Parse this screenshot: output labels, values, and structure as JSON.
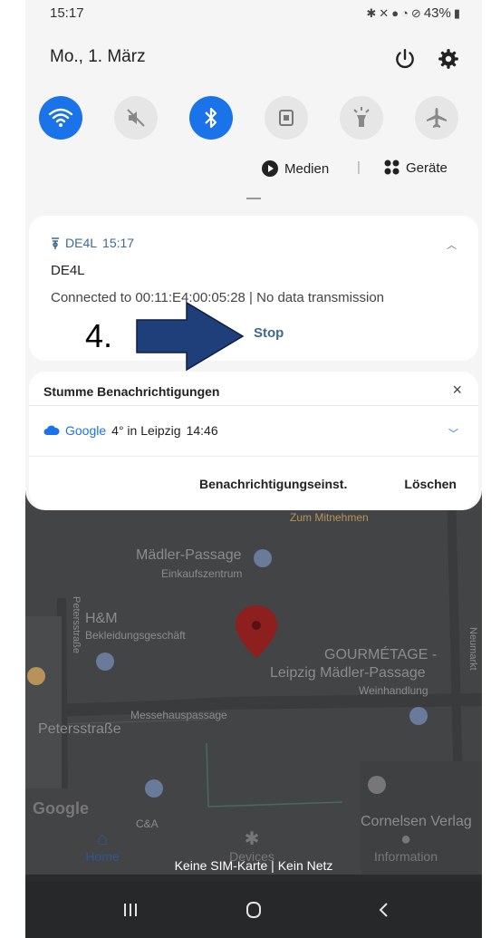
{
  "status_bar": {
    "time": "15:17",
    "battery": "43%",
    "icons": [
      "bluetooth-icon",
      "mute-icon",
      "location-icon",
      "wifi-icon",
      "no-data-icon",
      "battery-icon"
    ]
  },
  "header": {
    "date": "Mo., 1. März",
    "icons": [
      "power-icon",
      "gear-icon"
    ]
  },
  "quick_toggles": [
    {
      "name": "wifi",
      "active": true
    },
    {
      "name": "sound-mute",
      "active": false
    },
    {
      "name": "bluetooth",
      "active": true
    },
    {
      "name": "rotation-lock",
      "active": false
    },
    {
      "name": "flashlight",
      "active": false
    },
    {
      "name": "airplane-mode",
      "active": false
    }
  ],
  "media_row": {
    "media_label": "Medien",
    "separator": "|",
    "devices_label": "Geräte"
  },
  "notification": {
    "app": "DE4L",
    "time": "15:17",
    "title": "DE4L",
    "text": "Connected to 00:11:E4:00:05:28 | No data transmission",
    "action": "Stop"
  },
  "annotation": {
    "number": "4."
  },
  "silent_group": {
    "title": "Stumme Benachrichtigungen",
    "close": "×",
    "app": "Google",
    "text": "4° in Leipzig",
    "time": "14:46",
    "settings_button": "Benachrichtigungseinst.",
    "clear_button": "Löschen"
  },
  "map": {
    "labels": {
      "takeaway": "Zum Mitnehmen",
      "passage": "Mädler-Passage",
      "passage_sub": "Einkaufszentrum",
      "hm": "H&M",
      "hm_sub": "Bekleidungsgeschäft",
      "gourmet": "GOURMÉTAGE -",
      "gourmet2": "Leipzig Mädler-Passage",
      "gourmet_sub": "Weinhandlung",
      "street1": "Messehauspassage",
      "street2": "Petersstraße",
      "street_vert": "Petersstraße",
      "street_vert2": "Neumarkt",
      "ca": "C&A",
      "cornelsen": "Cornelsen Verlag",
      "google": "Google"
    }
  },
  "app_nav": {
    "home": "Home",
    "devices": "Devices",
    "information": "Information"
  },
  "toast": "Keine SIM-Karte | Kein Netz",
  "colors": {
    "accent": "#1a73e8",
    "notif_accent": "#3d6a8f",
    "annotation_arrow": "#1f3f7a"
  }
}
